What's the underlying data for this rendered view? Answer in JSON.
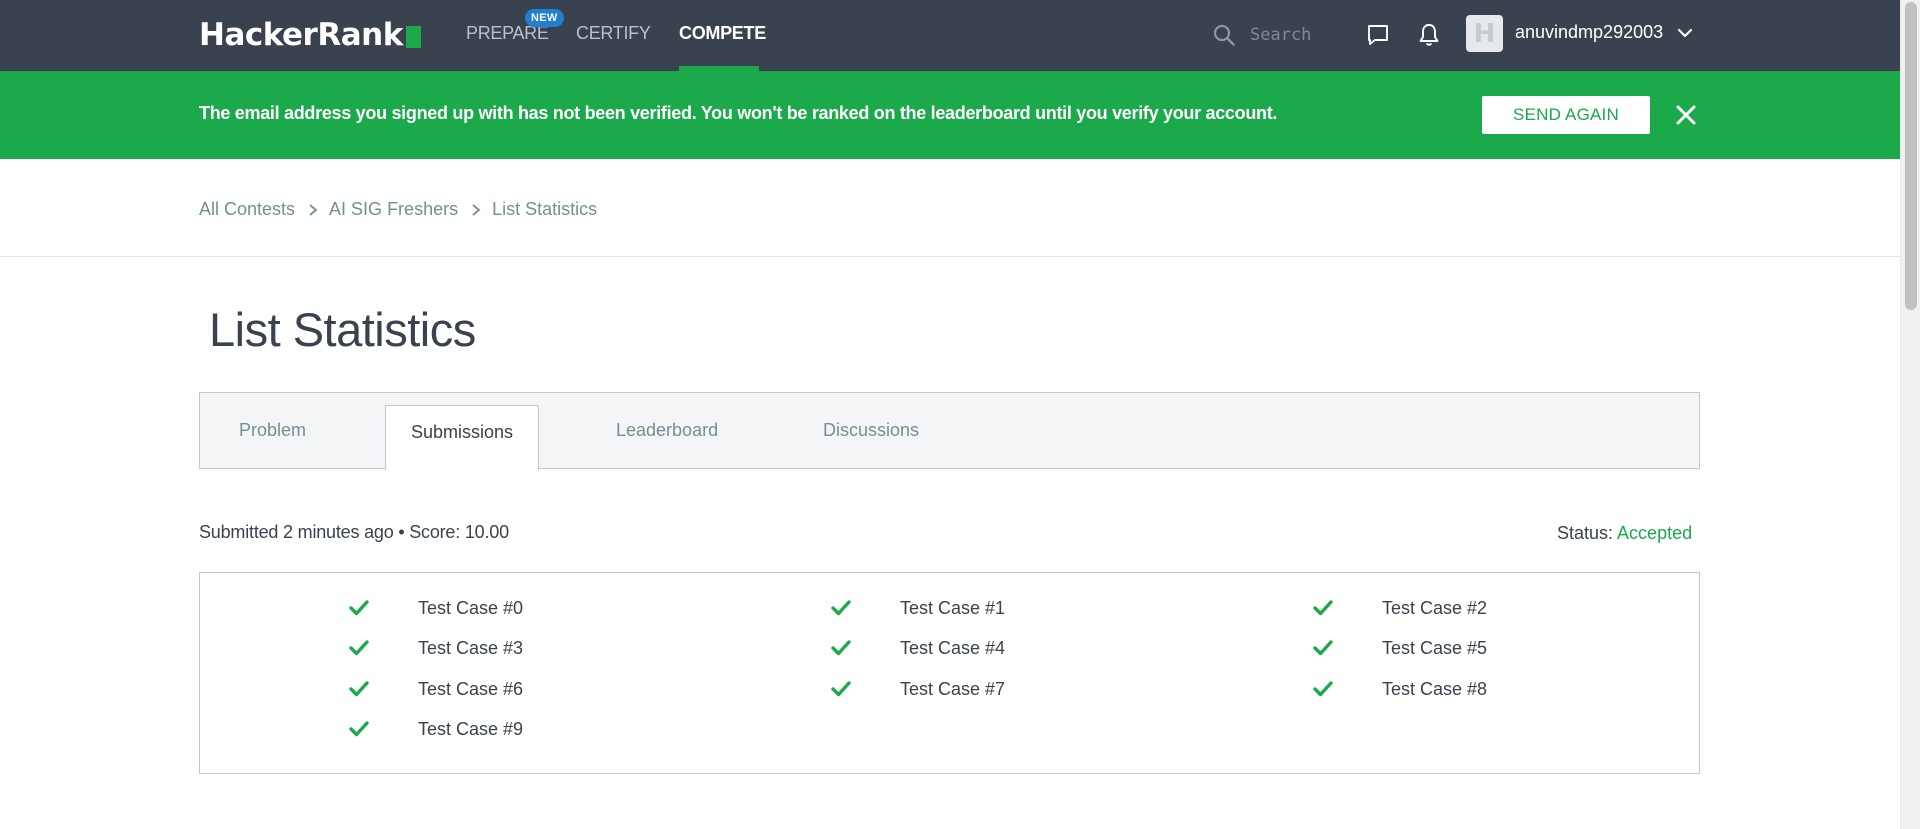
{
  "nav": {
    "logo": "HackerRank",
    "links": {
      "prepare": "PREPARE",
      "certify": "CERTIFY",
      "compete": "COMPETE"
    },
    "new_badge": "NEW",
    "search_placeholder": "Search",
    "username": "anuvindmp292003",
    "avatar_letter": "H",
    "active": "compete"
  },
  "banner": {
    "message": "The email address you signed up with has not been verified. You won't be ranked on the leaderboard until you verify your account.",
    "button": "SEND AGAIN"
  },
  "breadcrumb": {
    "items": [
      "All Contests",
      "AI SIG Freshers",
      "List Statistics"
    ]
  },
  "page_title": "List Statistics",
  "tabs": [
    {
      "label": "Problem",
      "active": false
    },
    {
      "label": "Submissions",
      "active": true
    },
    {
      "label": "Leaderboard",
      "active": false
    },
    {
      "label": "Discussions",
      "active": false
    }
  ],
  "submission": {
    "summary": "Submitted 2 minutes ago • Score: 10.00",
    "status_label": "Status:",
    "status_value": "Accepted"
  },
  "test_cases": [
    {
      "label": "Test Case #0",
      "passed": true
    },
    {
      "label": "Test Case #1",
      "passed": true
    },
    {
      "label": "Test Case #2",
      "passed": true
    },
    {
      "label": "Test Case #3",
      "passed": true
    },
    {
      "label": "Test Case #4",
      "passed": true
    },
    {
      "label": "Test Case #5",
      "passed": true
    },
    {
      "label": "Test Case #6",
      "passed": true
    },
    {
      "label": "Test Case #7",
      "passed": true
    },
    {
      "label": "Test Case #8",
      "passed": true
    },
    {
      "label": "Test Case #9",
      "passed": true
    }
  ],
  "colors": {
    "nav_bg": "#39424e",
    "accent_green": "#1ba94c",
    "badge_blue": "#1f7fd1",
    "muted_text": "#738f93"
  }
}
